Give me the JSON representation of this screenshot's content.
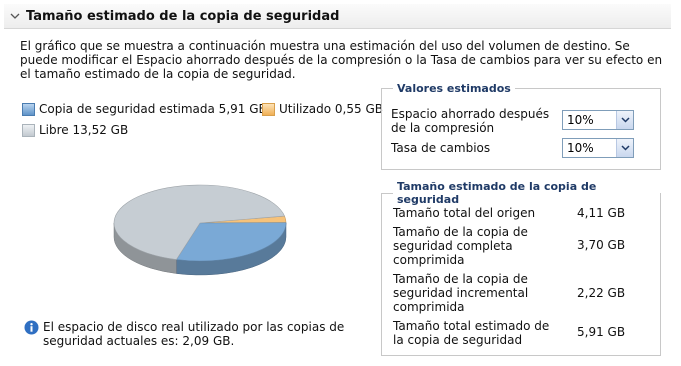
{
  "header": {
    "title": "Tamaño estimado de la copia de seguridad",
    "icon": "chevron-down-icon"
  },
  "description": "El gráfico que se muestra a continuación muestra una estimación del uso del volumen de destino. Se puede modificar el Espacio ahorrado después de la compresión o la Tasa de cambios para ver su efecto en el tamaño estimado de la copia de seguridad.",
  "legend": {
    "estimated": {
      "label": "Copia de seguridad estimada 5,91 GB",
      "color": "#7aa9d6"
    },
    "used": {
      "label": "Utilizado 0,55 GB",
      "color": "#f6c27a"
    },
    "free": {
      "label": "Libre 13,52 GB",
      "color": "#c6cdd3"
    }
  },
  "chart_data": {
    "type": "pie",
    "slices": [
      {
        "name": "Copia de seguridad estimada",
        "value": 5.91,
        "color": "#7aa9d6"
      },
      {
        "name": "Utilizado",
        "value": 0.55,
        "color": "#f6c27a"
      },
      {
        "name": "Libre",
        "value": 13.52,
        "color": "#c6cdd3"
      }
    ]
  },
  "info_text": "El espacio de disco real utilizado por las copias de seguridad actuales es: 2,09 GB.",
  "estimated_values": {
    "title": "Valores estimados",
    "compression_label": "Espacio ahorrado después de la compresión",
    "compression_value": "10%",
    "change_rate_label": "Tasa de cambios",
    "change_rate_value": "10%"
  },
  "estimated_size": {
    "title": "Tamaño estimado de la copia de seguridad",
    "rows": [
      {
        "label": "Tamaño total del origen",
        "value": "4,11 GB"
      },
      {
        "label": "Tamaño de la copia de seguridad completa comprimida",
        "value": "3,70 GB"
      },
      {
        "label": "Tamaño de la copia de seguridad incremental comprimida",
        "value": "2,22 GB"
      },
      {
        "label": "Tamaño total estimado de la copia de seguridad",
        "value": "5,91 GB"
      }
    ]
  }
}
